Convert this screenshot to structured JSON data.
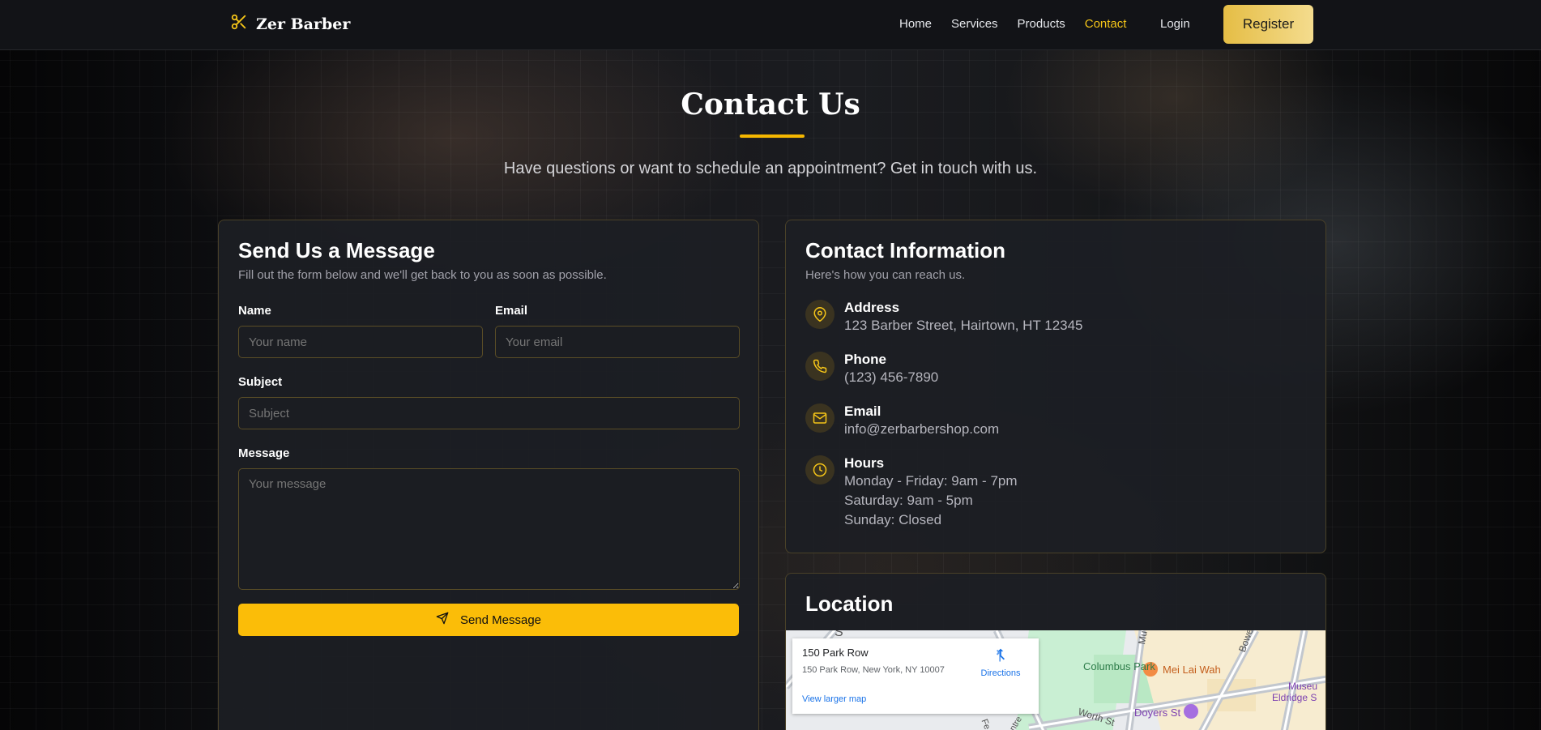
{
  "nav": {
    "brand": "Zer Barber",
    "links": [
      "Home",
      "Services",
      "Products",
      "Contact"
    ],
    "login": "Login",
    "register": "Register",
    "accent": "#f5c518"
  },
  "hero": {
    "title": "Contact Us",
    "subtitle": "Have questions or want to schedule an appointment? Get in touch with us."
  },
  "form": {
    "title": "Send Us a Message",
    "subtitle": "Fill out the form below and we'll get back to you as soon as possible.",
    "name_label": "Name",
    "name_placeholder": "Your name",
    "email_label": "Email",
    "email_placeholder": "Your email",
    "subject_label": "Subject",
    "subject_placeholder": "Subject",
    "message_label": "Message",
    "message_placeholder": "Your message",
    "send_label": "Send Message"
  },
  "info": {
    "title": "Contact Information",
    "subtitle": "Here's how you can reach us.",
    "items": [
      {
        "label": "Address",
        "icon": "map-pin-icon",
        "lines": [
          "123 Barber Street, Hairtown, HT 12345"
        ]
      },
      {
        "label": "Phone",
        "icon": "phone-icon",
        "lines": [
          "(123) 456-7890"
        ]
      },
      {
        "label": "Email",
        "icon": "mail-icon",
        "lines": [
          "info@zerbarbershop.com"
        ]
      },
      {
        "label": "Hours",
        "icon": "clock-icon",
        "lines": [
          "Monday - Friday: 9am - 7pm",
          "Saturday: 9am - 5pm",
          "Sunday: Closed"
        ]
      }
    ]
  },
  "location": {
    "title": "Location",
    "map": {
      "place_name": "150 Park Row",
      "address": "150 Park Row, New York, NY 10007",
      "directions": "Directions",
      "larger_map": "View larger map",
      "labels": {
        "columbus_park": "Columbus Park",
        "mei_lai_wah": "Mei Lai Wah",
        "doyers_st": "Doyers St",
        "bowery": "Bowery",
        "museum": "Museu",
        "eldridge": "Eldridge S",
        "worth_st": "Worth St",
        "mu": "Mu",
        "s": "S",
        "fe": "Fe",
        "entre": "entre"
      }
    }
  }
}
